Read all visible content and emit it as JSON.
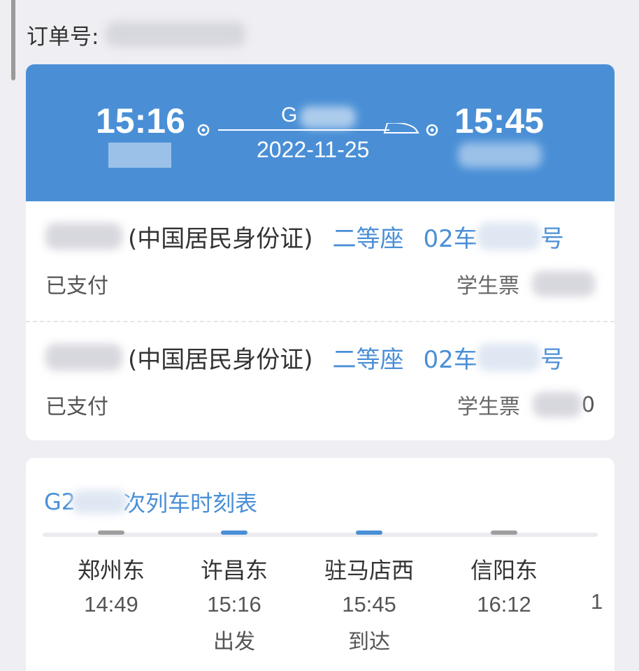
{
  "order": {
    "label": "订单号:"
  },
  "trip": {
    "depart_time": "15:16",
    "arrive_time": "15:45",
    "train_no": "G",
    "date": "2022-11-25"
  },
  "passengers": [
    {
      "id_type": "(中国居民身份证)",
      "seat_class": "二等座",
      "car": "02车",
      "seat_suffix": "号",
      "status": "已支付",
      "ticket_type": "学生票",
      "price_tail": ""
    },
    {
      "id_type": "(中国居民身份证)",
      "seat_class": "二等座",
      "car": "02车",
      "seat_suffix": "号",
      "status": "已支付",
      "ticket_type": "学生票",
      "price_tail": "0"
    }
  ],
  "timetable": {
    "title_prefix": "G2",
    "title_suffix": "次列车时刻表",
    "stops": [
      {
        "name": "郑州东",
        "time": "14:49",
        "label": ""
      },
      {
        "name": "许昌东",
        "time": "15:16",
        "label": "出发"
      },
      {
        "name": "驻马店西",
        "time": "15:45",
        "label": "到达"
      },
      {
        "name": "信阳东",
        "time": "16:12",
        "label": ""
      }
    ],
    "next_peek": "1"
  },
  "colors": {
    "accent": "#4a8fd6",
    "background": "#eeeef3"
  }
}
